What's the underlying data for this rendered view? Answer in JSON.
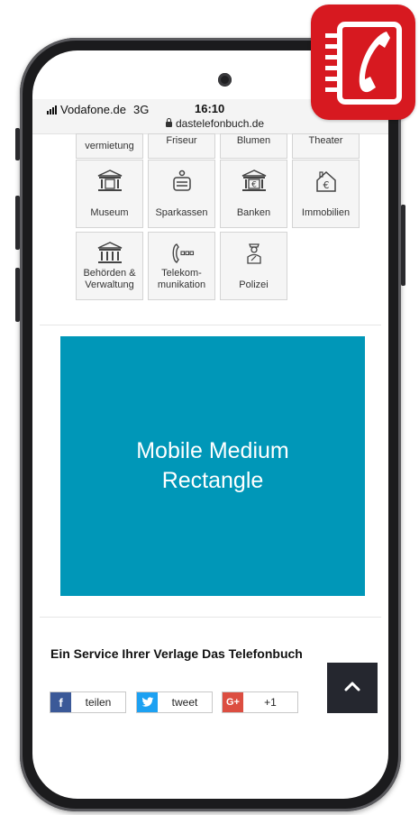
{
  "status_bar": {
    "carrier": "Vodafone.de",
    "network": "3G",
    "time": "16:10",
    "url": "dastelefonbuch.de"
  },
  "categories_partial": [
    {
      "label": "vermietung",
      "icon": "building-icon"
    },
    {
      "label": "Friseur",
      "icon": "scissors-icon"
    },
    {
      "label": "Blumen",
      "icon": "flower-icon"
    },
    {
      "label": "Theater",
      "icon": "theater-icon"
    }
  ],
  "categories": [
    {
      "label": "Museum",
      "icon": "museum-icon"
    },
    {
      "label": "Sparkassen",
      "icon": "savings-bank-icon"
    },
    {
      "label": "Banken",
      "icon": "bank-icon"
    },
    {
      "label": "Immobilien",
      "icon": "house-euro-icon"
    },
    {
      "label": "Behörden &\nVerwaltung",
      "icon": "government-building-icon"
    },
    {
      "label": "Telekom-\nmunikation",
      "icon": "phone-icon"
    },
    {
      "label": "Polizei",
      "icon": "police-officer-icon"
    }
  ],
  "ad": {
    "text": "Mobile Medium\nRectangle"
  },
  "footer": {
    "service_title": "Ein Service Ihrer Verlage Das Telefonbuch",
    "share": [
      {
        "label": "teilen",
        "icon": "facebook-icon",
        "icon_text": "f",
        "color": "#3b5998"
      },
      {
        "label": "tweet",
        "icon": "twitter-icon",
        "icon_text": "",
        "color": "#1da1f2"
      },
      {
        "label": "+1",
        "icon": "google-plus-icon",
        "icon_text": "G+",
        "color": "#dc4e41"
      }
    ]
  },
  "scroll_top": {
    "icon": "chevron-up-icon"
  },
  "brand": {
    "logo": "das-telefonbuch-logo",
    "color": "#d71920"
  }
}
